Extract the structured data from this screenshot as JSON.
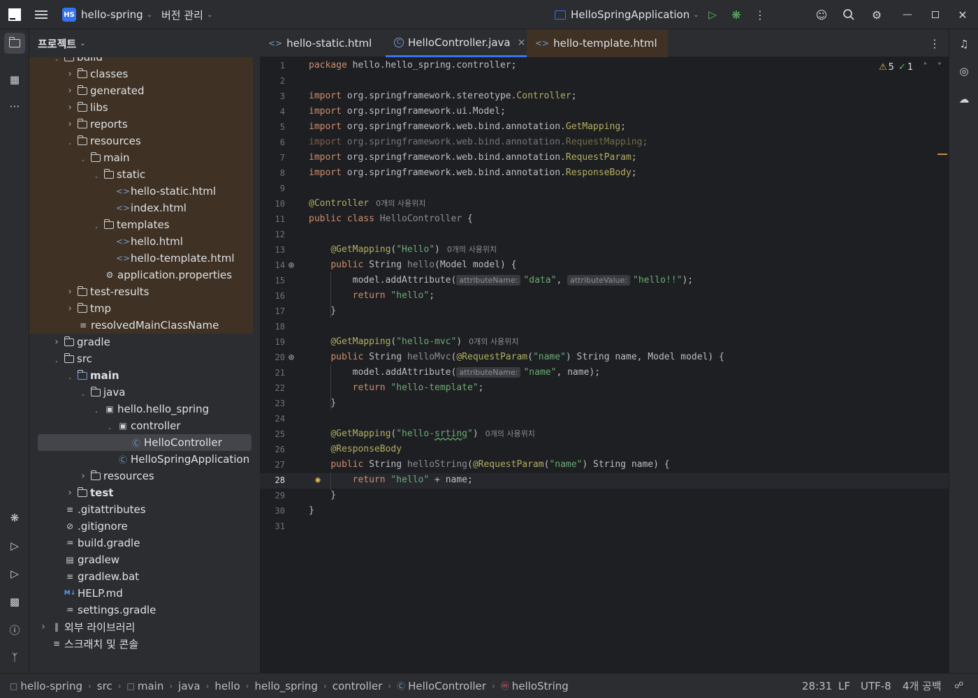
{
  "titlebar": {
    "project_badge": "HS",
    "project_name": "hello-spring",
    "vcs_label": "버전 관리",
    "run_config": "HelloSpringApplication"
  },
  "project_panel": {
    "title": "프로젝트",
    "rows": [
      {
        "label": "build",
        "depth": 2,
        "kind": "folder",
        "arrow": "open",
        "hl": true
      },
      {
        "label": "classes",
        "depth": 3,
        "kind": "folder",
        "arrow": "closed",
        "hl": true
      },
      {
        "label": "generated",
        "depth": 3,
        "kind": "folder",
        "arrow": "closed",
        "hl": true
      },
      {
        "label": "libs",
        "depth": 3,
        "kind": "folder",
        "arrow": "closed",
        "hl": true
      },
      {
        "label": "reports",
        "depth": 3,
        "kind": "folder",
        "arrow": "closed",
        "hl": true
      },
      {
        "label": "resources",
        "depth": 3,
        "kind": "folder",
        "arrow": "open",
        "hl": true
      },
      {
        "label": "main",
        "depth": 4,
        "kind": "folder",
        "arrow": "open",
        "hl": true
      },
      {
        "label": "static",
        "depth": 5,
        "kind": "folder",
        "arrow": "open",
        "hl": true
      },
      {
        "label": "hello-static.html",
        "depth": 6,
        "kind": "html",
        "arrow": "",
        "hl": true
      },
      {
        "label": "index.html",
        "depth": 6,
        "kind": "html",
        "arrow": "",
        "hl": true
      },
      {
        "label": "templates",
        "depth": 5,
        "kind": "folder",
        "arrow": "open",
        "hl": true
      },
      {
        "label": "hello.html",
        "depth": 6,
        "kind": "html",
        "arrow": "",
        "hl": true
      },
      {
        "label": "hello-template.html",
        "depth": 6,
        "kind": "html",
        "arrow": "",
        "hl": true
      },
      {
        "label": "application.properties",
        "depth": 5,
        "kind": "settings",
        "arrow": "",
        "hl": true
      },
      {
        "label": "test-results",
        "depth": 3,
        "kind": "folder",
        "arrow": "closed",
        "hl": true
      },
      {
        "label": "tmp",
        "depth": 3,
        "kind": "folder",
        "arrow": "closed",
        "hl": true
      },
      {
        "label": "resolvedMainClassName",
        "depth": 3,
        "kind": "text",
        "arrow": "",
        "hl": true
      },
      {
        "label": "gradle",
        "depth": 2,
        "kind": "folder",
        "arrow": "closed",
        "hl": false
      },
      {
        "label": "src",
        "depth": 2,
        "kind": "folder",
        "arrow": "open",
        "hl": false
      },
      {
        "label": "main",
        "depth": 3,
        "kind": "folder",
        "arrow": "open",
        "hl": false,
        "bold": true
      },
      {
        "label": "java",
        "depth": 4,
        "kind": "folder",
        "arrow": "open",
        "hl": false
      },
      {
        "label": "hello.hello_spring",
        "depth": 5,
        "kind": "package",
        "arrow": "open",
        "hl": false
      },
      {
        "label": "controller",
        "depth": 6,
        "kind": "package",
        "arrow": "open",
        "hl": false
      },
      {
        "label": "HelloController",
        "depth": 7,
        "kind": "class",
        "arrow": "",
        "hl": false,
        "selected": true
      },
      {
        "label": "HelloSpringApplication",
        "depth": 6,
        "kind": "class-run",
        "arrow": "",
        "hl": false
      },
      {
        "label": "resources",
        "depth": 4,
        "kind": "folder",
        "arrow": "closed",
        "hl": false
      },
      {
        "label": "test",
        "depth": 3,
        "kind": "folder",
        "arrow": "closed",
        "hl": false,
        "bold": true
      },
      {
        "label": ".gitattributes",
        "depth": 2,
        "kind": "text",
        "arrow": "",
        "hl": false
      },
      {
        "label": ".gitignore",
        "depth": 2,
        "kind": "ignore",
        "arrow": "",
        "hl": false
      },
      {
        "label": "build.gradle",
        "depth": 2,
        "kind": "gradle",
        "arrow": "",
        "hl": false
      },
      {
        "label": "gradlew",
        "depth": 2,
        "kind": "script",
        "arrow": "",
        "hl": false
      },
      {
        "label": "gradlew.bat",
        "depth": 2,
        "kind": "text",
        "arrow": "",
        "hl": false
      },
      {
        "label": "HELP.md",
        "depth": 2,
        "kind": "md",
        "arrow": "",
        "hl": false
      },
      {
        "label": "settings.gradle",
        "depth": 2,
        "kind": "gradle",
        "arrow": "",
        "hl": false
      },
      {
        "label": "외부 라이브러리",
        "depth": 1,
        "kind": "library",
        "arrow": "closed",
        "hl": false
      },
      {
        "label": "스크래치 및 콘솔",
        "depth": 1,
        "kind": "scratch",
        "arrow": "",
        "hl": false
      }
    ]
  },
  "tabs": [
    {
      "label": "hello-static.html",
      "icon": "<>",
      "active": false
    },
    {
      "label": "HelloController.java",
      "icon": "C",
      "active": true,
      "close": "×"
    },
    {
      "label": "hello-template.html",
      "icon": "<>",
      "active": false
    }
  ],
  "inspections": {
    "warnings": "5",
    "ok": "1"
  },
  "usage_hint": "0개의 사용위치",
  "hints": {
    "attr_name": "attributeName:",
    "attr_value": "attributeValue:"
  },
  "code_lines": [
    "1",
    "2",
    "3",
    "4",
    "5",
    "6",
    "7",
    "8",
    "9",
    "10",
    "11",
    "12",
    "13",
    "14",
    "15",
    "16",
    "17",
    "18",
    "19",
    "20",
    "21",
    "22",
    "23",
    "24",
    "25",
    "26",
    "27",
    "28",
    "29",
    "30",
    "31"
  ],
  "status": {
    "crumbs": [
      "hello-spring",
      "src",
      "main",
      "java",
      "hello",
      "hello_spring",
      "controller",
      "HelloController",
      "helloString"
    ],
    "position": "28:31",
    "line_sep": "LF",
    "encoding": "UTF-8",
    "indent": "4개 공백"
  }
}
